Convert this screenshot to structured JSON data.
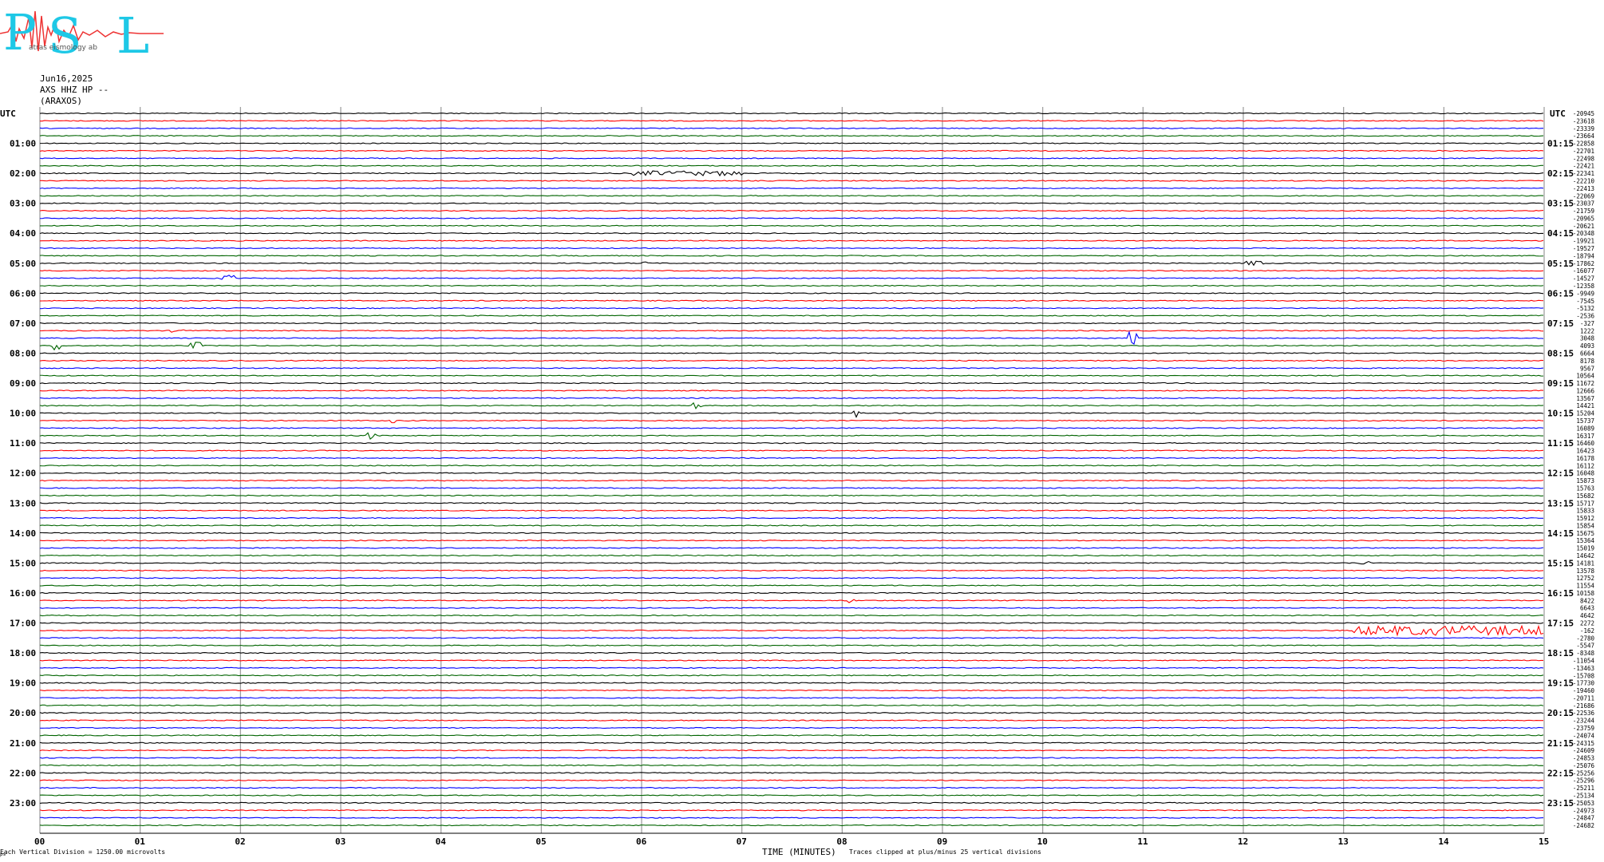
{
  "logo": {
    "letters": [
      "P",
      "S",
      "L"
    ],
    "small_text": "atras  eismology  ab",
    "colors": {
      "letters": "#1ec8e6",
      "wave": "#ee3333",
      "small": "#555555"
    }
  },
  "header": {
    "date": "Jun16,2025",
    "station": "AXS HHZ HP --",
    "location": "(ARAXOS)"
  },
  "chart_data": {
    "type": "line",
    "title": "",
    "xlabel": "TIME (MINUTES)",
    "ylabel": "UTC",
    "xlim": [
      0,
      15
    ],
    "x_ticks": [
      "00",
      "01",
      "02",
      "03",
      "04",
      "05",
      "06",
      "07",
      "08",
      "09",
      "10",
      "11",
      "12",
      "13",
      "14",
      "15"
    ],
    "left_axis_label": "UTC",
    "right_axis_label": "UTC",
    "left_hour_labels": [
      "01:00",
      "02:00",
      "03:00",
      "04:00",
      "05:00",
      "06:00",
      "07:00",
      "08:00",
      "09:00",
      "10:00",
      "11:00",
      "12:00",
      "13:00",
      "14:00",
      "15:00",
      "16:00",
      "17:00",
      "18:00",
      "19:00",
      "20:00",
      "21:00",
      "22:00",
      "23:00"
    ],
    "right_hour_labels": [
      "01:15",
      "02:15",
      "03:15",
      "04:15",
      "05:15",
      "06:15",
      "07:15",
      "08:15",
      "09:15",
      "10:15",
      "11:15",
      "12:15",
      "13:15",
      "14:15",
      "15:15",
      "16:15",
      "17:15",
      "18:15",
      "19:15",
      "20:15",
      "21:15",
      "22:15",
      "23:15"
    ],
    "trace_offsets": [
      "-20945",
      "-23618",
      "-23339",
      "-23664",
      "-22858",
      "-22701",
      "-22498",
      "-22421",
      "-22341",
      "-22210",
      "-22413",
      "-22069",
      "-23037",
      "-21759",
      "-20965",
      "-20621",
      "-20348",
      "-19921",
      "-19527",
      "-18794",
      "-17862",
      "-16077",
      "-14527",
      "-12358",
      "-9949",
      "-7545",
      "-5132",
      "-2536",
      "-327",
      "1222",
      "3048",
      "4093",
      "6664",
      "8178",
      "9567",
      "10564",
      "11672",
      "12666",
      "13567",
      "14421",
      "15204",
      "15737",
      "16089",
      "16317",
      "16460",
      "16423",
      "16178",
      "16112",
      "16048",
      "15873",
      "15763",
      "15682",
      "15717",
      "15833",
      "15912",
      "15854",
      "15675",
      "15364",
      "15019",
      "14642",
      "14181",
      "13578",
      "12752",
      "11554",
      "10158",
      "8422",
      "6643",
      "4642",
      "2272",
      "-162",
      "-2780",
      "-5547",
      "-8348",
      "-11054",
      "-13463",
      "-15708",
      "-17730",
      "-19460",
      "-20711",
      "-21686",
      "-22536",
      "-23244",
      "-23759",
      "-24074",
      "-24315",
      "-24609",
      "-24853",
      "-25076",
      "-25256",
      "-25296",
      "-25211",
      "-25134",
      "-25053",
      "-24973",
      "-24847",
      "-24682"
    ],
    "trace_colors": [
      "#000000",
      "#ff0000",
      "#0000ff",
      "#006400"
    ],
    "trace_count": 96,
    "minutes_per_trace": 15,
    "events": [
      {
        "trace": 8,
        "start": 5.9,
        "end": 7.0,
        "amp": 3
      },
      {
        "trace": 20,
        "start": 6.0,
        "end": 6.05,
        "amp": 3
      },
      {
        "trace": 20,
        "start": 12.0,
        "end": 12.2,
        "amp": 3
      },
      {
        "trace": 22,
        "start": 1.8,
        "end": 1.95,
        "amp": 4
      },
      {
        "trace": 29,
        "start": 1.3,
        "end": 1.45,
        "amp": 2
      },
      {
        "trace": 30,
        "start": 10.85,
        "end": 10.95,
        "amp": 8
      },
      {
        "trace": 31,
        "start": 0.1,
        "end": 0.2,
        "amp": 6
      },
      {
        "trace": 31,
        "start": 1.5,
        "end": 1.6,
        "amp": 5
      },
      {
        "trace": 39,
        "start": 6.5,
        "end": 6.6,
        "amp": 4
      },
      {
        "trace": 40,
        "start": 8.1,
        "end": 8.17,
        "amp": 5
      },
      {
        "trace": 41,
        "start": 3.5,
        "end": 3.55,
        "amp": 3
      },
      {
        "trace": 41,
        "start": 8.55,
        "end": 8.65,
        "amp": 3
      },
      {
        "trace": 43,
        "start": 3.25,
        "end": 3.35,
        "amp": 5
      },
      {
        "trace": 65,
        "start": 8.05,
        "end": 8.12,
        "amp": 5
      },
      {
        "trace": 60,
        "start": 13.15,
        "end": 13.25,
        "amp": 2
      },
      {
        "trace": 69,
        "start": 13.1,
        "end": 15.0,
        "amp": 6
      }
    ],
    "notes": {
      "division": "Each Vertical Division = 1250.00 microvolts",
      "clip": "Traces clipped at plus/minus 25 vertical divisions"
    },
    "grid": true
  },
  "footer": {
    "left": "Each Vertical Division = 1250.00 microvolts",
    "center": "TIME (MINUTES)",
    "clip": "Traces clipped at plus/minus 25 vertical divisions",
    "corner": "ps"
  }
}
